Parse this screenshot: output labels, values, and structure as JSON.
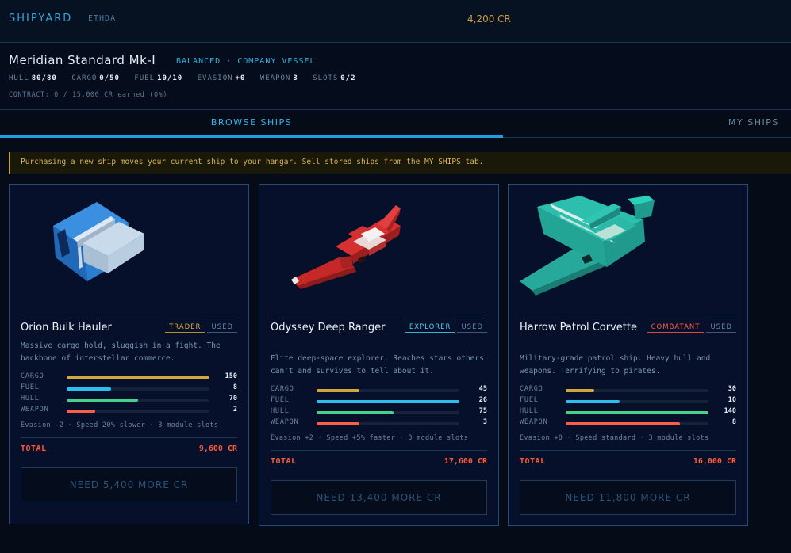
{
  "header": {
    "brand": "SHIPYARD",
    "sub": "ETHDA",
    "credits": "4,200 CR"
  },
  "current_ship": {
    "name": "Meridian Standard Mk-I",
    "tags": "BALANCED · COMPANY VESSEL",
    "stats": [
      {
        "label": "HULL",
        "value": "80/80"
      },
      {
        "label": "CARGO",
        "value": "0/50"
      },
      {
        "label": "FUEL",
        "value": "10/10"
      },
      {
        "label": "EVASION",
        "value": "+0"
      },
      {
        "label": "WEAPON",
        "value": "3"
      },
      {
        "label": "SLOTS",
        "value": "0/2"
      }
    ],
    "contract": "CONTRACT: 0 / 15,000 CR earned (0%)"
  },
  "tabs": {
    "browse": "BROWSE SHIPS",
    "my": "MY SHIPS"
  },
  "notice": "Purchasing a new ship moves your current ship to your hangar. Sell stored ships from the MY SHIPS tab.",
  "colors": {
    "cargo": "#d4a640",
    "fuel": "#2fbef0",
    "hull": "#46d08a",
    "weapon": "#ff5c4a"
  },
  "ships": [
    {
      "name": "Orion Bulk Hauler",
      "role": "TRADER",
      "condition": "USED",
      "description": "Massive cargo hold, sluggish in a fight. The backbone of interstellar commerce.",
      "stats": [
        {
          "label": "CARGO",
          "value": "150",
          "fill": 1.0
        },
        {
          "label": "FUEL",
          "value": "8",
          "fill": 0.31
        },
        {
          "label": "HULL",
          "value": "70",
          "fill": 0.5
        },
        {
          "label": "WEAPON",
          "value": "2",
          "fill": 0.2
        }
      ],
      "footer": "Evasion -2 · Speed 20% slower · 3 module slots",
      "total_label": "TOTAL",
      "total": "9,600 CR",
      "button": "NEED 5,400 MORE CR"
    },
    {
      "name": "Odyssey Deep Ranger",
      "role": "EXPLORER",
      "condition": "USED",
      "description": "Elite deep-space explorer. Reaches stars others can't and survives to tell about it.",
      "stats": [
        {
          "label": "CARGO",
          "value": "45",
          "fill": 0.3
        },
        {
          "label": "FUEL",
          "value": "26",
          "fill": 1.0
        },
        {
          "label": "HULL",
          "value": "75",
          "fill": 0.54
        },
        {
          "label": "WEAPON",
          "value": "3",
          "fill": 0.3
        }
      ],
      "footer": "Evasion +2 · Speed +5% faster · 3 module slots",
      "total_label": "TOTAL",
      "total": "17,600 CR",
      "button": "NEED 13,400 MORE CR"
    },
    {
      "name": "Harrow Patrol Corvette",
      "role": "COMBATANT",
      "condition": "USED",
      "description": "Military-grade patrol ship. Heavy hull and weapons. Terrifying to pirates.",
      "stats": [
        {
          "label": "CARGO",
          "value": "30",
          "fill": 0.2
        },
        {
          "label": "FUEL",
          "value": "10",
          "fill": 0.38
        },
        {
          "label": "HULL",
          "value": "140",
          "fill": 1.0
        },
        {
          "label": "WEAPON",
          "value": "8",
          "fill": 0.8
        }
      ],
      "footer": "Evasion +0 · Speed standard · 3 module slots",
      "total_label": "TOTAL",
      "total": "16,000 CR",
      "button": "NEED 11,800 MORE CR"
    }
  ]
}
